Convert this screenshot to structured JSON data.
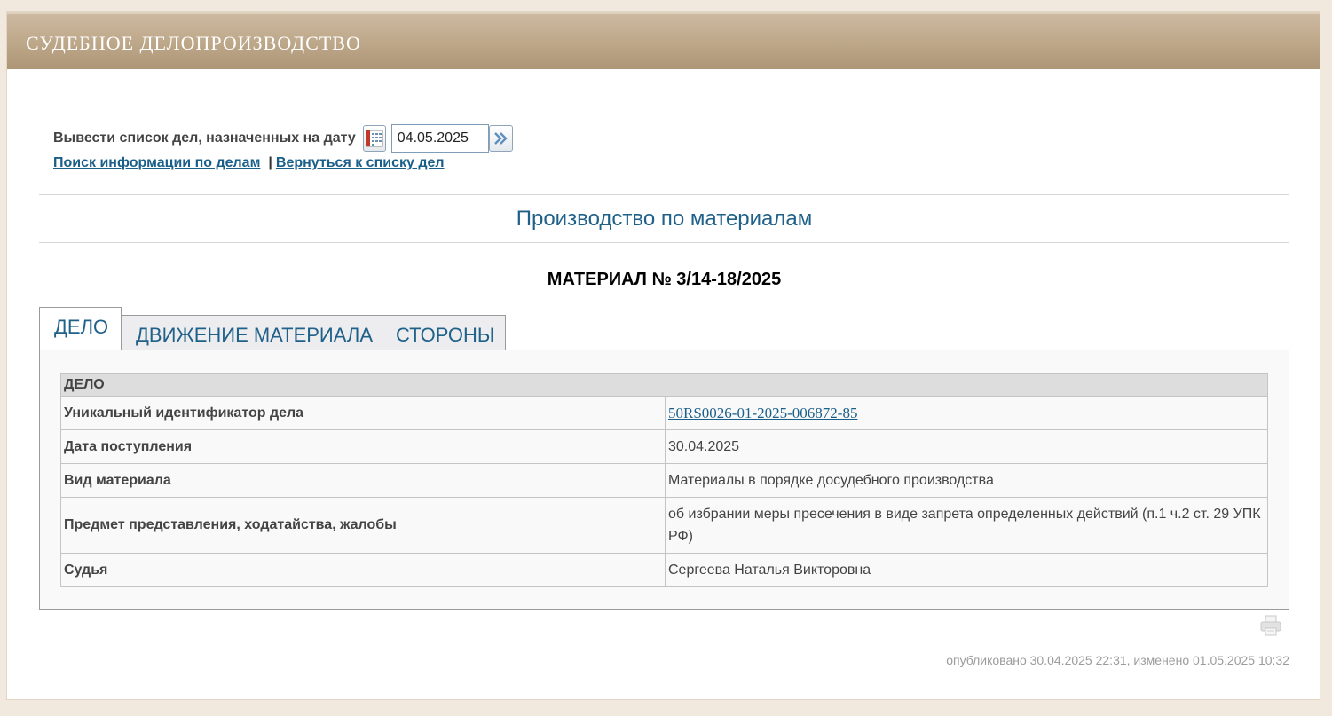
{
  "header": {
    "title": "СУДЕБНОЕ ДЕЛОПРОИЗВОДСТВО"
  },
  "date_filter": {
    "label": "Вывести список дел, назначенных на дату",
    "value": "04.05.2025",
    "calendar_icon": "calendar-icon",
    "go_icon": "double-chevron-right-icon"
  },
  "links": {
    "search": "Поиск информации по делам",
    "separator": "|",
    "back": "Вернуться к списку дел"
  },
  "section_title": "Производство по материалам",
  "material_title": "МАТЕРИАЛ № 3/14-18/2025",
  "tabs": [
    {
      "label": "ДЕЛО",
      "active": true
    },
    {
      "label": "ДВИЖЕНИЕ МАТЕРИАЛА",
      "active": false
    },
    {
      "label": "СТОРОНЫ",
      "active": false
    }
  ],
  "case_table": {
    "heading": "ДЕЛО",
    "rows": [
      {
        "label": "Уникальный идентификатор дела",
        "value": "50RS0026-01-2025-006872-85"
      },
      {
        "label": "Дата поступления",
        "value": "30.04.2025"
      },
      {
        "label": "Вид материала",
        "value": "Материалы в порядке досудебного производства"
      },
      {
        "label": "Предмет представления, ходатайства, жалобы",
        "value": "об избрании меры пресечения в виде запрета определенных действий (п.1 ч.2 ст. 29 УПК РФ)"
      },
      {
        "label": "Судья",
        "value": "Сергеева Наталья Викторовна"
      }
    ]
  },
  "print_icon": "printer-icon",
  "published": "опубликовано 30.04.2025 22:31, изменено 01.05.2025 10:32",
  "colors": {
    "header_top": "#ccb9a0",
    "header_bottom": "#ad9676",
    "link": "#1a5e8a",
    "accent_title": "#1f6189",
    "page_bg": "#f1e9dd"
  }
}
